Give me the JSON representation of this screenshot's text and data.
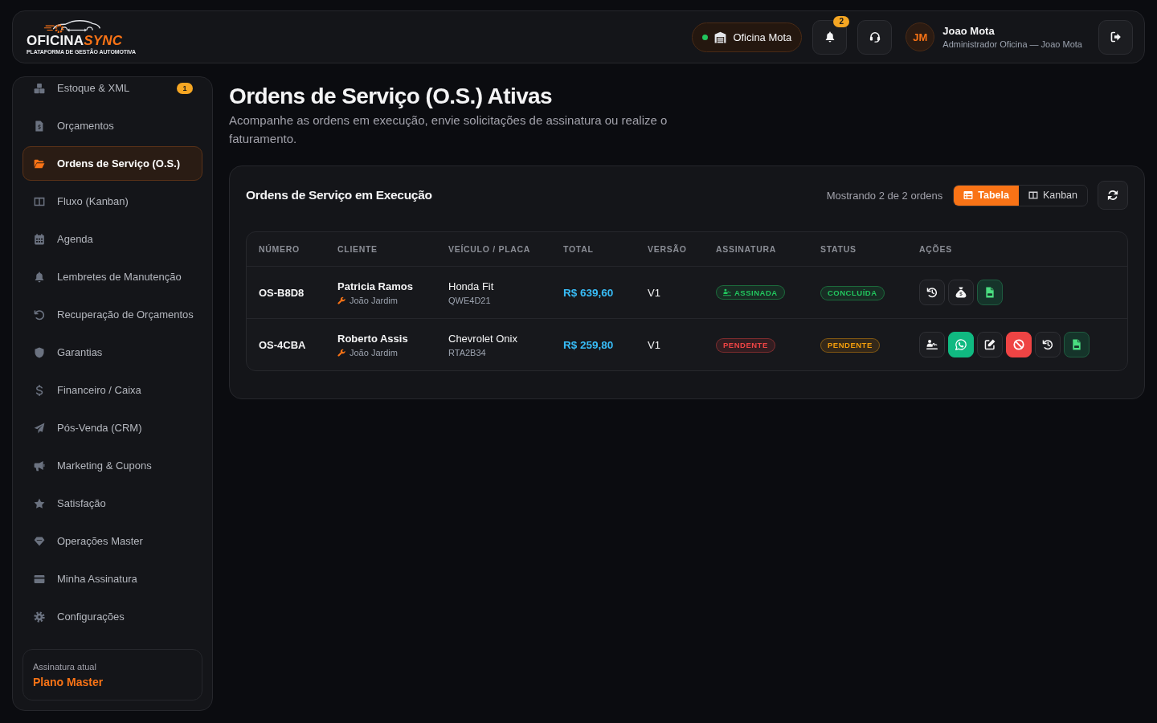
{
  "header": {
    "logo": {
      "name_start": "OFICINA",
      "name_end": "SYNC",
      "tagline": "PLATAFORMA DE GESTÃO AUTOMOTIVA"
    },
    "workshop": {
      "label": "Oficina Mota",
      "online": true
    },
    "notifications": {
      "count": "2"
    },
    "user": {
      "initials": "JM",
      "name": "Joao Mota",
      "role": "Administrador Oficina — Joao Mota"
    }
  },
  "sidebar": {
    "items": [
      {
        "label": "Estoque & XML",
        "selected": false,
        "badge": "1"
      },
      {
        "label": "Orçamentos",
        "selected": false
      },
      {
        "label": "Ordens de Serviço (O.S.)",
        "selected": true
      },
      {
        "label": "Fluxo (Kanban)",
        "selected": false
      },
      {
        "label": "Agenda",
        "selected": false
      },
      {
        "label": "Lembretes de Manutenção",
        "selected": false
      },
      {
        "label": "Recuperação de Orçamentos",
        "selected": false
      },
      {
        "label": "Garantias",
        "selected": false
      },
      {
        "label": "Financeiro / Caixa",
        "selected": false
      },
      {
        "label": "Pós-Venda (CRM)",
        "selected": false
      },
      {
        "label": "Marketing & Cupons",
        "selected": false
      },
      {
        "label": "Satisfação",
        "selected": false
      },
      {
        "label": "Operações Master",
        "selected": false
      },
      {
        "label": "Minha Assinatura",
        "selected": false
      },
      {
        "label": "Configurações",
        "selected": false
      }
    ],
    "plan": {
      "caption": "Assinatura atual",
      "name": "Plano Master"
    }
  },
  "page": {
    "title": "Ordens de Serviço (O.S.) Ativas",
    "subtitle": "Acompanhe as ordens em execução, envie solicitações de assinatura ou realize o faturamento."
  },
  "orders_card": {
    "title": "Ordens de Serviço em Execução",
    "count_text": "Mostrando 2 de 2 ordens",
    "view_tabs": [
      {
        "label": "Tabela",
        "selected": true
      },
      {
        "label": "Kanban",
        "selected": false
      }
    ],
    "table": {
      "columns": [
        "NÚMERO",
        "CLIENTE",
        "VEÍCULO / PLACA",
        "TOTAL",
        "VERSÃO",
        "ASSINATURA",
        "STATUS",
        "AÇÕES"
      ],
      "rows": [
        {
          "number": "OS-B8D8",
          "client": "Patricia Ramos",
          "mechanic": "João Jardim",
          "vehicle": "Honda Fit",
          "plate": "QWE4D21",
          "total": "R$ 639,60",
          "version": "V1",
          "signature": {
            "label": "ASSINADA",
            "signed": true,
            "color": "#22c55e"
          },
          "status": {
            "label": "CONCLUÍDA",
            "color": "#22c55e"
          },
          "actions": [
            {
              "kind": "history"
            },
            {
              "kind": "payment"
            },
            {
              "kind": "pdf"
            }
          ]
        },
        {
          "number": "OS-4CBA",
          "client": "Roberto Assis",
          "mechanic": "João Jardim",
          "vehicle": "Chevrolet Onix",
          "plate": "RTA2B34",
          "total": "R$ 259,80",
          "version": "V1",
          "signature": {
            "label": "PENDENTE",
            "signed": false,
            "color": "#ef4444"
          },
          "status": {
            "label": "PENDENTE",
            "color": "#f59e0b"
          },
          "actions": [
            {
              "kind": "signature"
            },
            {
              "kind": "whatsapp"
            },
            {
              "kind": "edit"
            },
            {
              "kind": "cancel"
            },
            {
              "kind": "history"
            },
            {
              "kind": "pdf"
            }
          ]
        }
      ]
    }
  }
}
